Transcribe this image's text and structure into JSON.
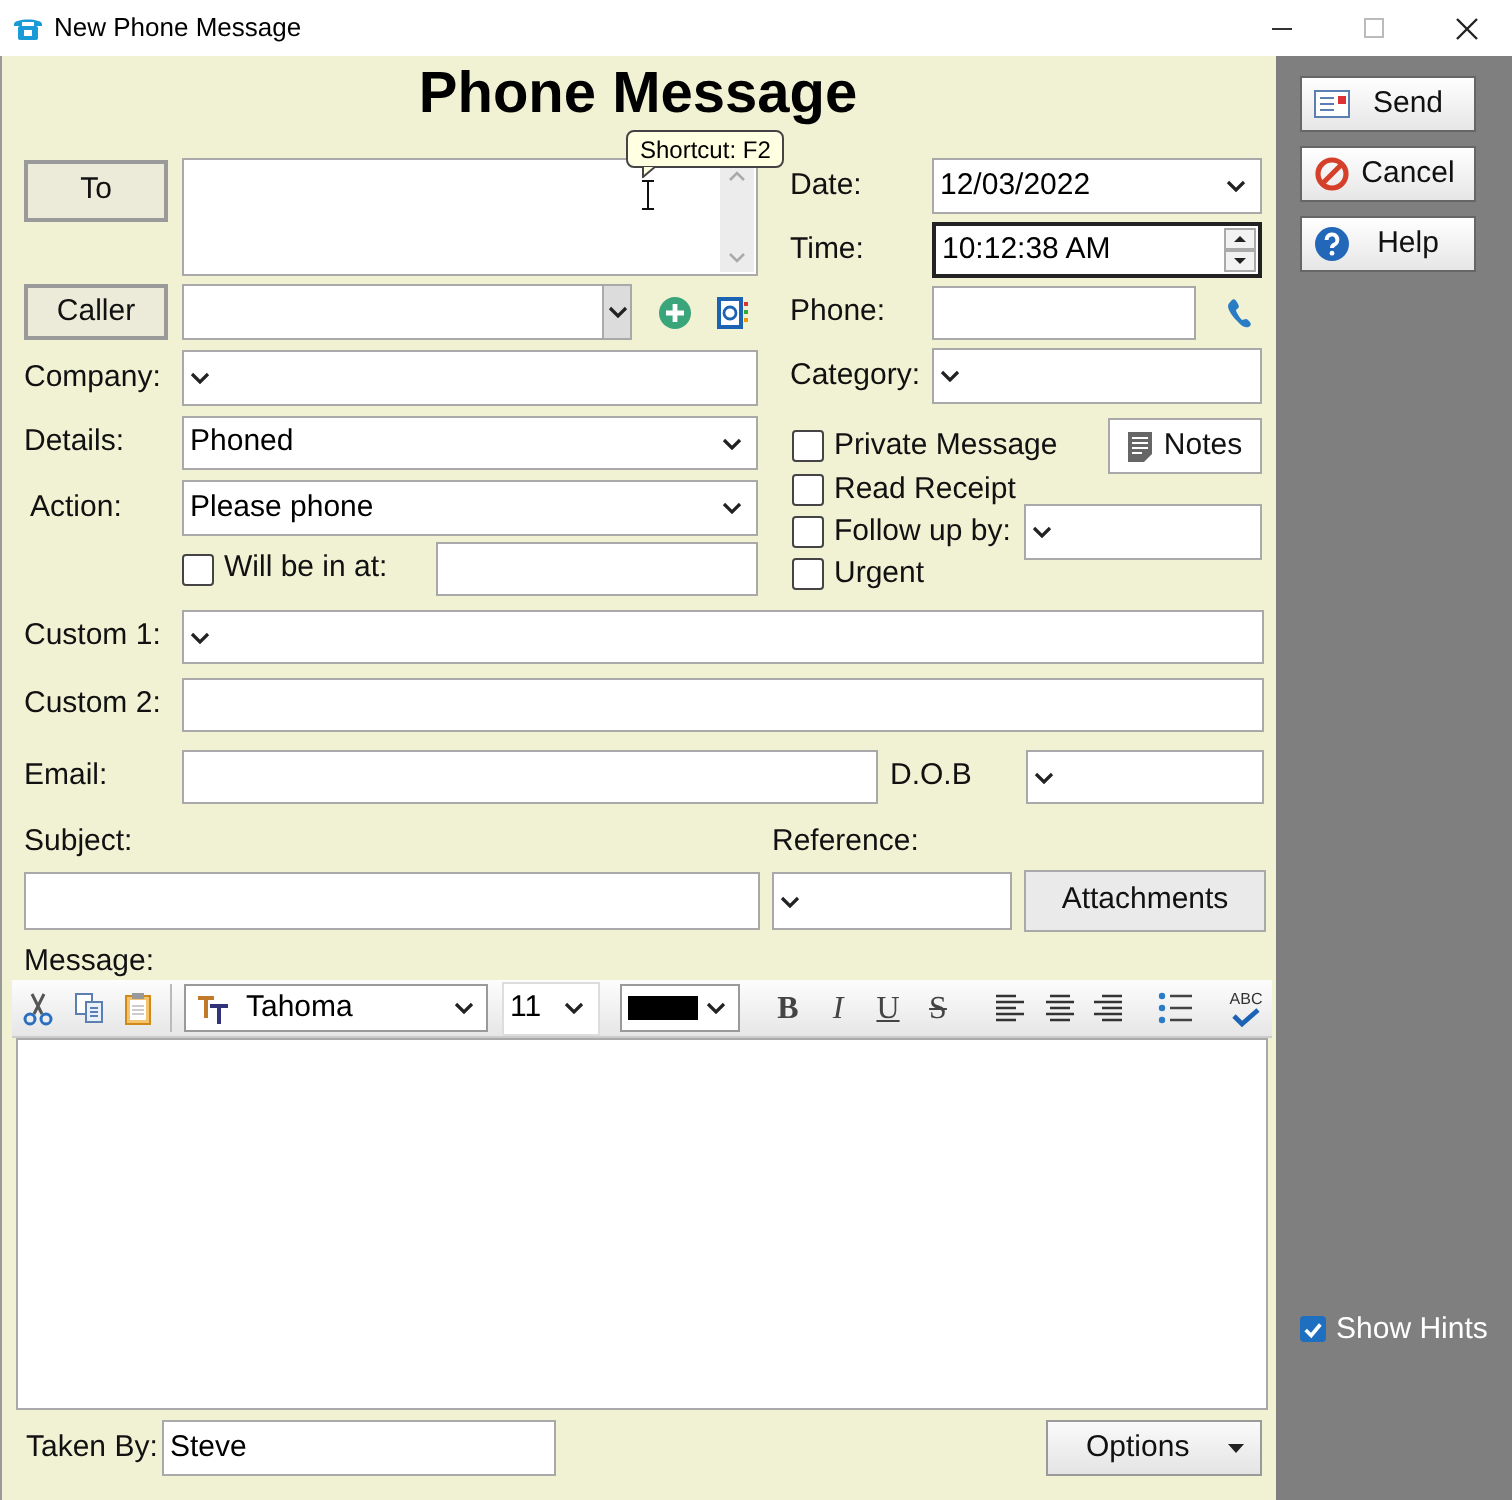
{
  "window": {
    "title": "New Phone Message"
  },
  "heading": "Phone Message",
  "tooltip": "Shortcut: F2",
  "to_button": "To",
  "caller_button": "Caller",
  "left_fields": [
    {
      "kind": "dropdown",
      "label": "Company:"
    },
    {
      "kind": "dropdown",
      "label": "Details:",
      "value": "Phoned"
    },
    {
      "kind": "dropdown",
      "label": "Action:",
      "value": "Please phone"
    }
  ],
  "will_be_in": {
    "label": "Will be in at:",
    "checked": false
  },
  "date": {
    "label": "Date:",
    "value": "12/03/2022"
  },
  "time": {
    "label": "Time:",
    "value": "10:12:38 AM",
    "focused": true
  },
  "phone": {
    "label": "Phone:"
  },
  "category": {
    "label": "Category:"
  },
  "flags": [
    {
      "label": "Private Message",
      "checked": false
    },
    {
      "label": "Read Receipt",
      "checked": false
    },
    {
      "label": "Follow up by:",
      "checked": false
    },
    {
      "label": "Urgent",
      "checked": false
    }
  ],
  "notes_button": "Notes",
  "custom_fields": [
    {
      "kind": "dropdown",
      "label": "Custom 1:"
    },
    {
      "kind": "text",
      "label": "Custom 2:"
    }
  ],
  "email": {
    "label": "Email:"
  },
  "dob": {
    "label": "D.O.B"
  },
  "subject": {
    "label": "Subject:"
  },
  "reference": {
    "label": "Reference:"
  },
  "attachments_button": "Attachments",
  "message_label": "Message:",
  "toolbar": {
    "font": "Tahoma",
    "size": "11",
    "color": "#000000",
    "format_buttons": [
      {
        "kind": "bold",
        "label": "B"
      },
      {
        "kind": "italic",
        "label": "I"
      },
      {
        "kind": "underline",
        "label": "U"
      },
      {
        "kind": "strike",
        "label": "S"
      }
    ],
    "spellcheck": "ABC"
  },
  "taken_by": {
    "label": "Taken By:",
    "value": "Steve"
  },
  "options_button": "Options",
  "side_buttons": [
    {
      "kind": "send",
      "label": "Send"
    },
    {
      "kind": "cancel",
      "label": "Cancel"
    },
    {
      "kind": "help",
      "label": "Help"
    }
  ],
  "show_hints": {
    "label": "Show Hints",
    "checked": true
  }
}
